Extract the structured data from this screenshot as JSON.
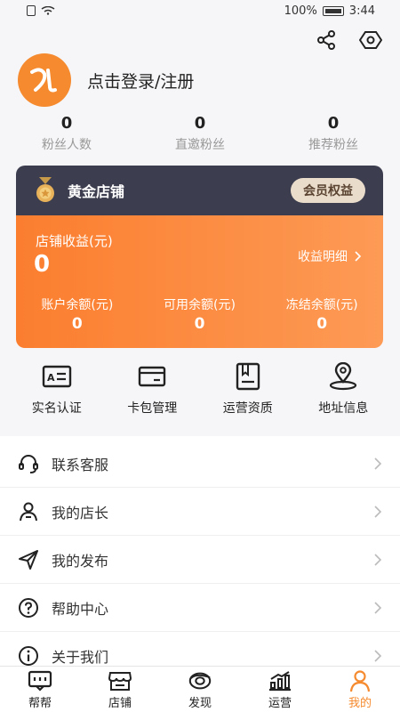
{
  "status_bar": {
    "battery": "100%",
    "time": "3:44"
  },
  "header": {
    "share_icon": "share-icon",
    "settings_icon": "hexagon-settings-icon"
  },
  "profile": {
    "login_text": "点击登录/注册"
  },
  "stats": [
    {
      "value": "0",
      "label": "粉丝人数"
    },
    {
      "value": "0",
      "label": "直邀粉丝"
    },
    {
      "value": "0",
      "label": "推荐粉丝"
    }
  ],
  "membership": {
    "tier": "黄金店铺",
    "benefit_button": "会员权益",
    "shop_income_label": "店铺收益(元)",
    "shop_income_value": "0",
    "income_detail": "收益明细",
    "balances": [
      {
        "label": "账户余额(元)",
        "value": "0"
      },
      {
        "label": "可用余额(元)",
        "value": "0"
      },
      {
        "label": "冻结余额(元)",
        "value": "0"
      }
    ],
    "colors": {
      "head": "#3c3d4e",
      "body_start": "#fb7e2f",
      "body_end": "#fd9a55",
      "benefit_bg": "#e9dccb"
    }
  },
  "shortcuts": [
    {
      "label": "实名认证",
      "icon": "id-card-icon"
    },
    {
      "label": "卡包管理",
      "icon": "card-wallet-icon"
    },
    {
      "label": "运营资质",
      "icon": "qualification-doc-icon"
    },
    {
      "label": "地址信息",
      "icon": "location-pin-icon"
    }
  ],
  "menu": [
    {
      "label": "联系客服",
      "icon": "headset-icon"
    },
    {
      "label": "我的店长",
      "icon": "person-icon"
    },
    {
      "label": "我的发布",
      "icon": "send-icon"
    },
    {
      "label": "帮助中心",
      "icon": "help-icon"
    },
    {
      "label": "关于我们",
      "icon": "info-icon"
    }
  ],
  "tabs": [
    {
      "label": "帮帮",
      "icon": "chat-box-icon",
      "active": false
    },
    {
      "label": "店铺",
      "icon": "store-icon",
      "active": false
    },
    {
      "label": "发现",
      "icon": "discover-icon",
      "active": false
    },
    {
      "label": "运营",
      "icon": "bar-chart-icon",
      "active": false
    },
    {
      "label": "我的",
      "icon": "profile-icon",
      "active": true
    }
  ],
  "accent_color": "#f58a2e"
}
